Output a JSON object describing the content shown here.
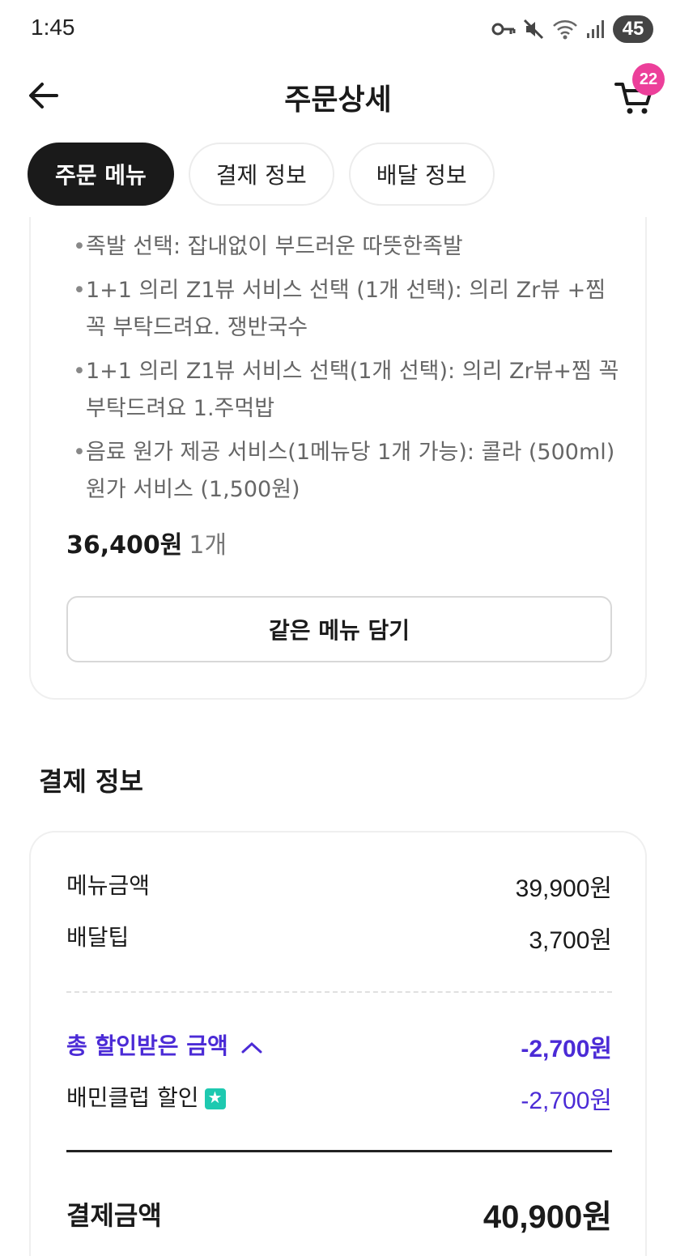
{
  "status_bar": {
    "time": "1:45",
    "battery": "45"
  },
  "header": {
    "title": "주문상세",
    "cart_count": "22"
  },
  "tabs": [
    {
      "label": "주문 메뉴",
      "active": true
    },
    {
      "label": "결제 정보",
      "active": false
    },
    {
      "label": "배달 정보",
      "active": false
    }
  ],
  "order": {
    "options": [
      "족발 선택: 잡내없이 부드러운 따뜻한족발",
      "1+1 의리 Z1뷰 서비스 선택 (1개 선택): 의리 Zr뷰 +찜 꼭 부탁드려요. 쟁반국수",
      "1+1 의리 Z1뷰 서비스 선택(1개 선택): 의리 Zr뷰+찜 꼭 부탁드려요 1.주먹밥",
      "음료 원가 제공 서비스(1메뉴당 1개 가능): 콜라 (500ml) 원가 서비스 (1,500원)"
    ],
    "price": "36,400원",
    "quantity": "1개",
    "same_menu_button": "같은 메뉴 담기"
  },
  "payment": {
    "section_title": "결제 정보",
    "menu_amount_label": "메뉴금액",
    "menu_amount_value": "39,900원",
    "delivery_tip_label": "배달팁",
    "delivery_tip_value": "3,700원",
    "total_discount_label": "총 할인받은 금액",
    "total_discount_value": "-2,700원",
    "club_discount_label": "배민클럽 할인",
    "club_discount_value": "-2,700원",
    "total_label": "결제금액",
    "total_value": "40,900원"
  },
  "colors": {
    "accent": "#4b2bd6",
    "badge": "#ec3f9a",
    "club": "#1ec9b0"
  }
}
